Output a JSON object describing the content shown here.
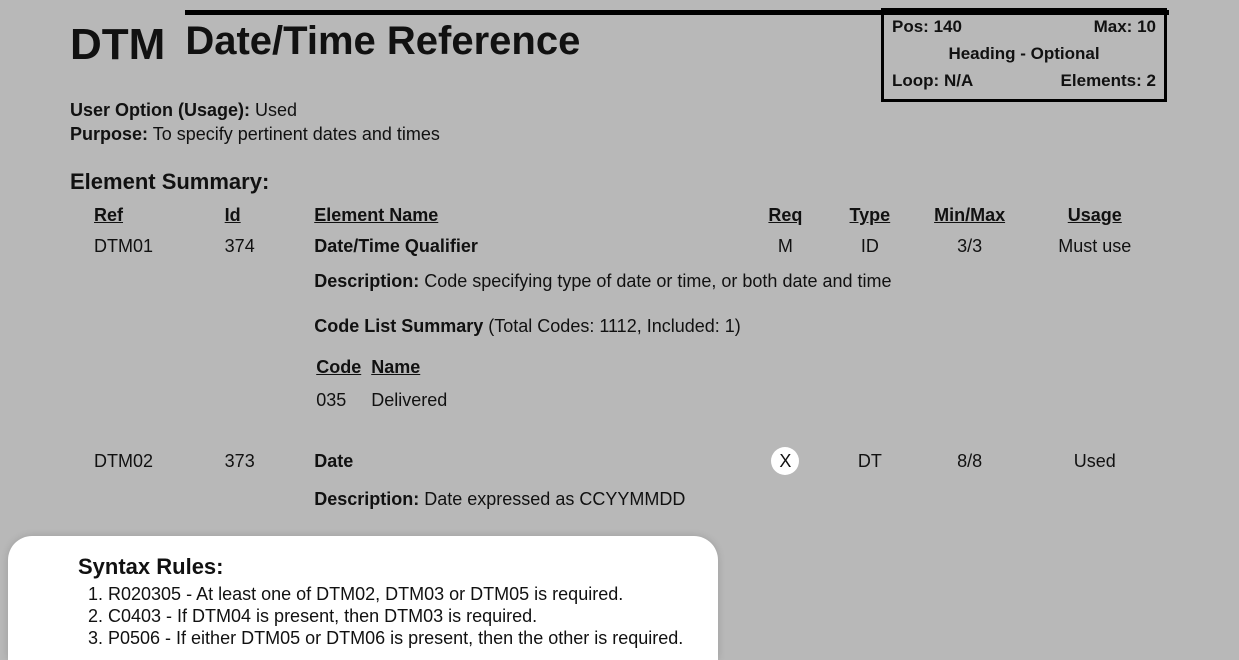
{
  "segment_id": "DTM",
  "segment_title": "Date/Time Reference",
  "posbox": {
    "pos_label": "Pos:",
    "pos_value": "140",
    "max_label": "Max:",
    "max_value": "10",
    "heading": "Heading - Optional",
    "loop_label": "Loop:",
    "loop_value": "N/A",
    "elements_label": "Elements:",
    "elements_value": "2"
  },
  "meta": {
    "usage_label": "User Option (Usage):",
    "usage_value": "Used",
    "purpose_label": "Purpose:",
    "purpose_value": "To specify pertinent dates and times"
  },
  "summary_heading": "Element Summary:",
  "columns": {
    "ref": "Ref",
    "id": "Id",
    "name": "Element Name",
    "req": "Req",
    "type": "Type",
    "minmax": "Min/Max",
    "usage": "Usage"
  },
  "rows": [
    {
      "ref": "DTM01",
      "id": "374",
      "name": "Date/Time Qualifier",
      "req": "M",
      "type": "ID",
      "minmax": "3/3",
      "usage": "Must use",
      "desc_label": "Description:",
      "desc": "Code specifying type of date or time, or both date and time",
      "codelist_label": "Code List Summary",
      "codelist_info": "(Total Codes: 1112, Included: 1)",
      "code_head": "Code",
      "name_head": "Name",
      "codes": [
        {
          "code": "035",
          "name": "Delivered"
        }
      ]
    },
    {
      "ref": "DTM02",
      "id": "373",
      "name": "Date",
      "req": "X",
      "req_circle": true,
      "type": "DT",
      "minmax": "8/8",
      "usage": "Used",
      "desc_label": "Description:",
      "desc": "Date expressed as CCYYMMDD"
    }
  ],
  "syntax": {
    "title": "Syntax Rules:",
    "items": [
      "R020305 - At least one of DTM02, DTM03 or DTM05 is required.",
      "C0403 - If DTM04 is present, then DTM03 is required.",
      "P0506 - If either DTM05 or DTM06 is present, then the other is required."
    ]
  }
}
